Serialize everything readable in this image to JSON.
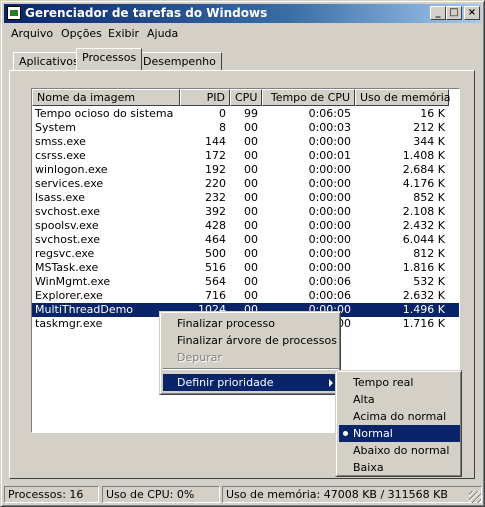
{
  "window": {
    "title": "Gerenciador de tarefas do Windows",
    "buttons": {
      "minimize": "_",
      "maximize": "□",
      "close": "×"
    }
  },
  "menu": [
    "Arquivo",
    "Opções",
    "Exibir",
    "Ajuda"
  ],
  "tabs": [
    {
      "label": "Aplicativos",
      "active": false
    },
    {
      "label": "Processos",
      "active": true
    },
    {
      "label": "Desempenho",
      "active": false
    }
  ],
  "table": {
    "columns": [
      "Nome da imagem",
      "PID",
      "CPU",
      "Tempo de CPU",
      "Uso de memória"
    ],
    "rows": [
      [
        "Tempo ocioso do sistema",
        "0",
        "99",
        "0:06:05",
        "16 K"
      ],
      [
        "System",
        "8",
        "00",
        "0:00:03",
        "212 K"
      ],
      [
        "smss.exe",
        "144",
        "00",
        "0:00:00",
        "344 K"
      ],
      [
        "csrss.exe",
        "172",
        "00",
        "0:00:01",
        "1.408 K"
      ],
      [
        "winlogon.exe",
        "192",
        "00",
        "0:00:00",
        "2.684 K"
      ],
      [
        "services.exe",
        "220",
        "00",
        "0:00:00",
        "4.176 K"
      ],
      [
        "lsass.exe",
        "232",
        "00",
        "0:00:00",
        "852 K"
      ],
      [
        "svchost.exe",
        "392",
        "00",
        "0:00:00",
        "2.108 K"
      ],
      [
        "spoolsv.exe",
        "428",
        "00",
        "0:00:00",
        "2.432 K"
      ],
      [
        "svchost.exe",
        "464",
        "00",
        "0:00:00",
        "6.044 K"
      ],
      [
        "regsvc.exe",
        "500",
        "00",
        "0:00:00",
        "812 K"
      ],
      [
        "MSTask.exe",
        "516",
        "00",
        "0:00:00",
        "1.816 K"
      ],
      [
        "WinMgmt.exe",
        "564",
        "00",
        "0:00:06",
        "532 K"
      ],
      [
        "Explorer.exe",
        "716",
        "00",
        "0:00:06",
        "2.632 K"
      ],
      [
        "MultiThreadDemo",
        "1024",
        "00",
        "0:00:00",
        "1.496 K"
      ],
      [
        "taskmgr.exe",
        "",
        "",
        "0:00",
        "1.716 K"
      ]
    ],
    "selected_index": 14
  },
  "context_menu": {
    "items": [
      {
        "label": "Finalizar processo",
        "disabled": false
      },
      {
        "label": "Finalizar árvore de processos",
        "disabled": false
      },
      {
        "label": "Depurar",
        "disabled": true
      },
      {
        "label": "Definir prioridade",
        "disabled": false,
        "submenu": true,
        "highlighted": true
      }
    ]
  },
  "priority_submenu": {
    "items": [
      "Tempo real",
      "Alta",
      "Acima do normal",
      "Normal",
      "Abaixo do normal",
      "Baixa"
    ],
    "selected_index": 3
  },
  "status_bar": {
    "processes": "Processos: 16",
    "cpu": "Uso de CPU: 0%",
    "memory": "Uso de memória: 47008 KB / 311568 KB"
  }
}
